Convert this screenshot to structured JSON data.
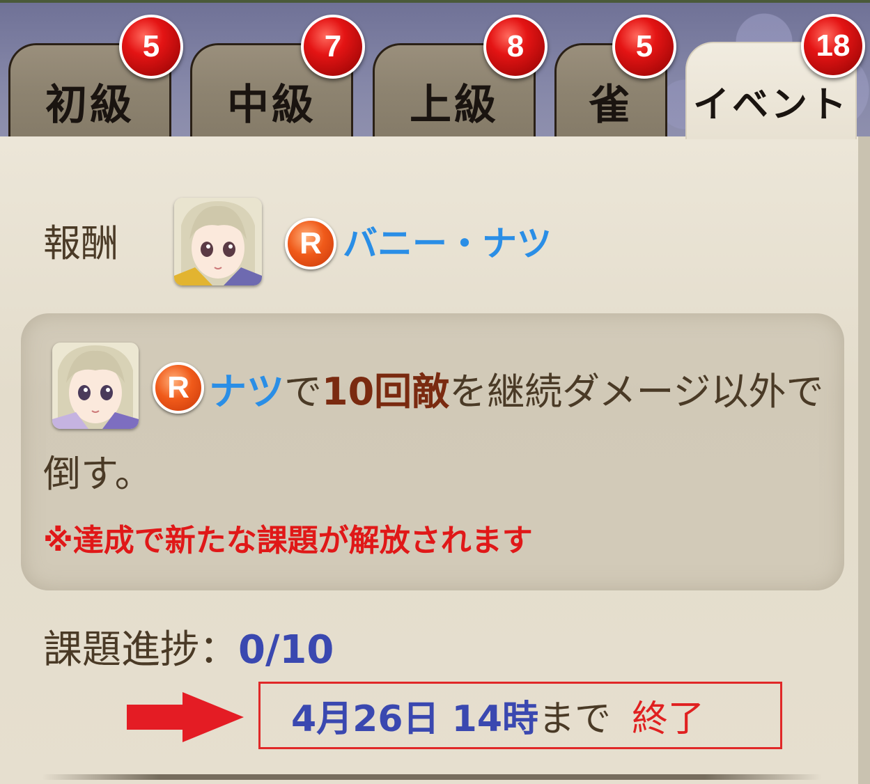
{
  "tabs": [
    {
      "label": "初級",
      "badge": "5"
    },
    {
      "label": "中級",
      "badge": "7"
    },
    {
      "label": "上級",
      "badge": "8"
    },
    {
      "label": "雀",
      "badge": "5"
    },
    {
      "label": "イベント",
      "badge": "18",
      "active": true
    }
  ],
  "reward": {
    "label": "報酬",
    "rarity": "R",
    "name": "バニー・ナツ"
  },
  "mission": {
    "rarity": "R",
    "character": "ナツ",
    "text_a": "で",
    "count": "10回敵",
    "text_b": "を継続ダメージ以外で",
    "text_c": "倒す。",
    "note": "※達成で新たな課題が解放されます"
  },
  "progress": {
    "label": "課題進捗：",
    "value": "0/10"
  },
  "deadline": {
    "date": "4月26日 14時",
    "suffix": "まで",
    "status": "終了"
  },
  "colors": {
    "badge_red": "#e41414",
    "character_blue": "#2a8ee6",
    "count_brown": "#7a2a10",
    "note_red": "#e01818",
    "progress_blue": "#3a48b0"
  }
}
